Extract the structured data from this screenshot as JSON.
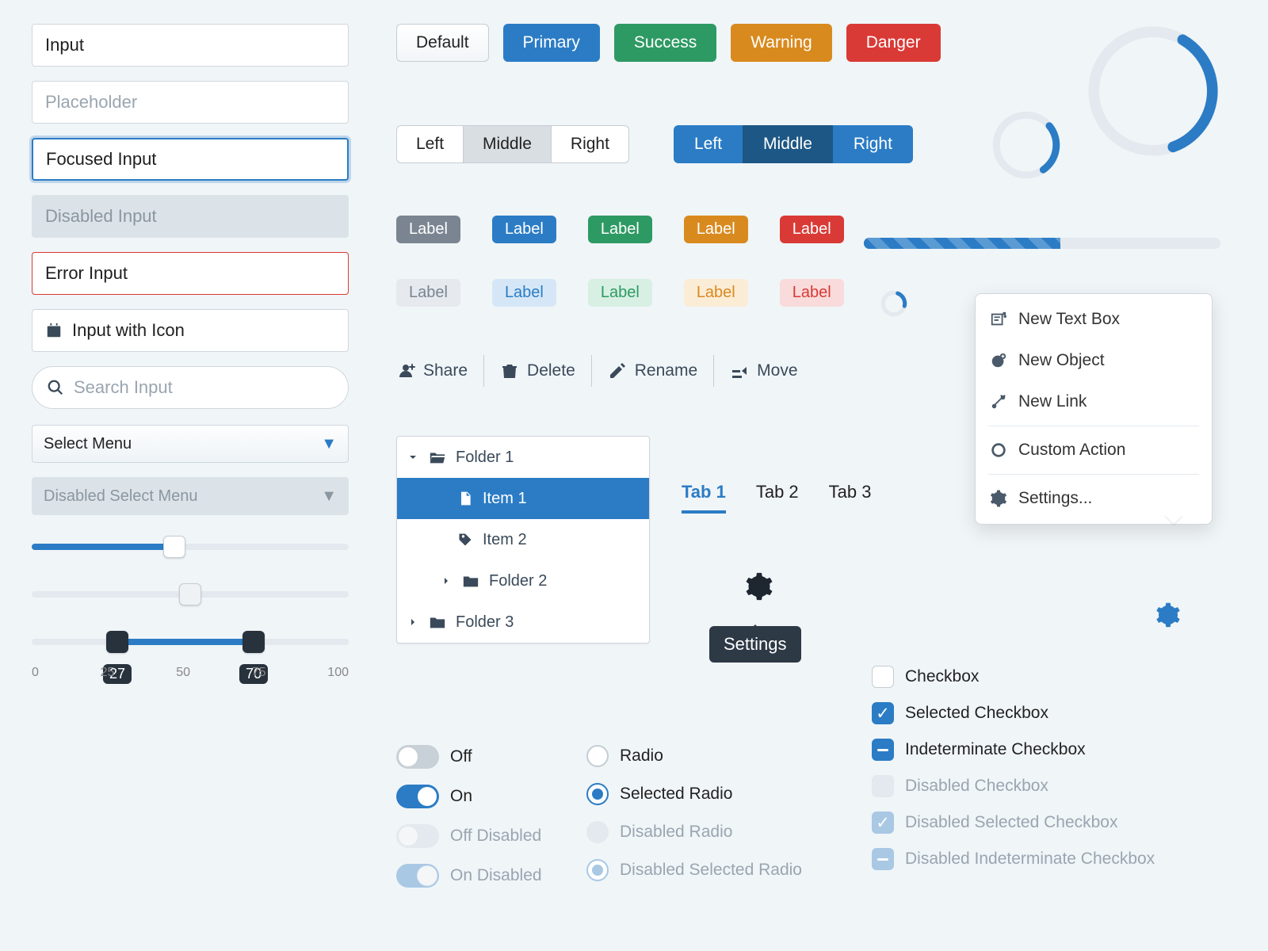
{
  "inputs": {
    "input": "Input",
    "placeholder": "Placeholder",
    "focused": "Focused Input",
    "disabled": "Disabled Input",
    "error": "Error Input",
    "with_icon": "Input with Icon",
    "search": "Search Input"
  },
  "selects": {
    "default": "Select Menu",
    "disabled": "Disabled Select Menu"
  },
  "sliders": {
    "single_value": 45,
    "disabled_value": 50,
    "range": {
      "min": 27,
      "max": 70
    },
    "ticks": [
      "0",
      "25",
      "50",
      "75",
      "100"
    ]
  },
  "buttons": {
    "default": "Default",
    "primary": "Primary",
    "success": "Success",
    "warning": "Warning",
    "danger": "Danger"
  },
  "segment_light": [
    "Left",
    "Middle",
    "Right"
  ],
  "segment_dark": [
    "Left",
    "Middle",
    "Right"
  ],
  "labels_solid": [
    "Label",
    "Label",
    "Label",
    "Label",
    "Label"
  ],
  "labels_light": [
    "Label",
    "Label",
    "Label",
    "Label",
    "Label"
  ],
  "toolbar": {
    "share": "Share",
    "delete": "Delete",
    "rename": "Rename",
    "move": "Move"
  },
  "tree": {
    "rows": [
      {
        "label": "Folder 1",
        "type": "folder-open",
        "indent": 0
      },
      {
        "label": "Item 1",
        "type": "file",
        "indent": 1,
        "selected": true
      },
      {
        "label": "Item 2",
        "type": "tag",
        "indent": 1
      },
      {
        "label": "Folder 2",
        "type": "folder",
        "indent": 1,
        "chev": true
      },
      {
        "label": "Folder 3",
        "type": "folder",
        "indent": 0,
        "chev": true
      }
    ]
  },
  "tabs": [
    "Tab 1",
    "Tab 2",
    "Tab 3"
  ],
  "tooltip": "Settings",
  "popover": {
    "items": [
      {
        "label": "New Text Box",
        "icon": "textbox"
      },
      {
        "label": "New Object",
        "icon": "circle-plus"
      },
      {
        "label": "New Link",
        "icon": "link"
      }
    ],
    "custom": "Custom Action",
    "settings": "Settings..."
  },
  "toggles": {
    "off": "Off",
    "on": "On",
    "off_disabled": "Off Disabled",
    "on_disabled": "On Disabled"
  },
  "radios": {
    "radio": "Radio",
    "selected": "Selected Radio",
    "disabled": "Disabled Radio",
    "disabled_selected": "Disabled Selected Radio"
  },
  "checks": {
    "checkbox": "Checkbox",
    "selected": "Selected Checkbox",
    "indeterminate": "Indeterminate Checkbox",
    "disabled": "Disabled Checkbox",
    "disabled_selected": "Disabled Selected Checkbox",
    "disabled_indeterminate": "Disabled Indeterminate Checkbox"
  },
  "colors": {
    "primary": "#2b7cc5",
    "success": "#2e9a63",
    "warning": "#d98a1e",
    "danger": "#d93a36",
    "gray": "#7a8591"
  }
}
